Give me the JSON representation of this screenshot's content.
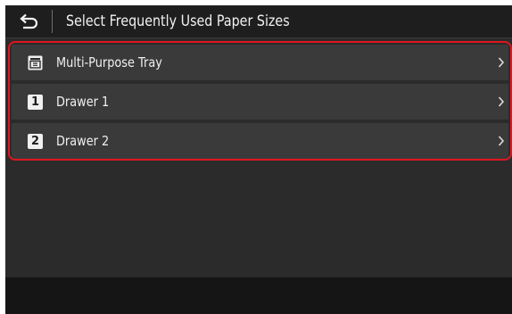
{
  "header": {
    "back_icon": "back-arrow-icon",
    "title": "Select Frequently Used Paper Sizes"
  },
  "sources": {
    "items": [
      {
        "icon": "tray-icon",
        "label": "Multi-Purpose Tray"
      },
      {
        "icon": "drawer-1-badge",
        "badge": "1",
        "label": "Drawer 1"
      },
      {
        "icon": "drawer-2-badge",
        "badge": "2",
        "label": "Drawer 2"
      }
    ],
    "chevron_icon": "chevron-right-icon"
  },
  "colors": {
    "highlight": "#e0161f",
    "panel": "#2b2b2b",
    "row": "#3a3a3a",
    "text": "#f0f0f0"
  }
}
